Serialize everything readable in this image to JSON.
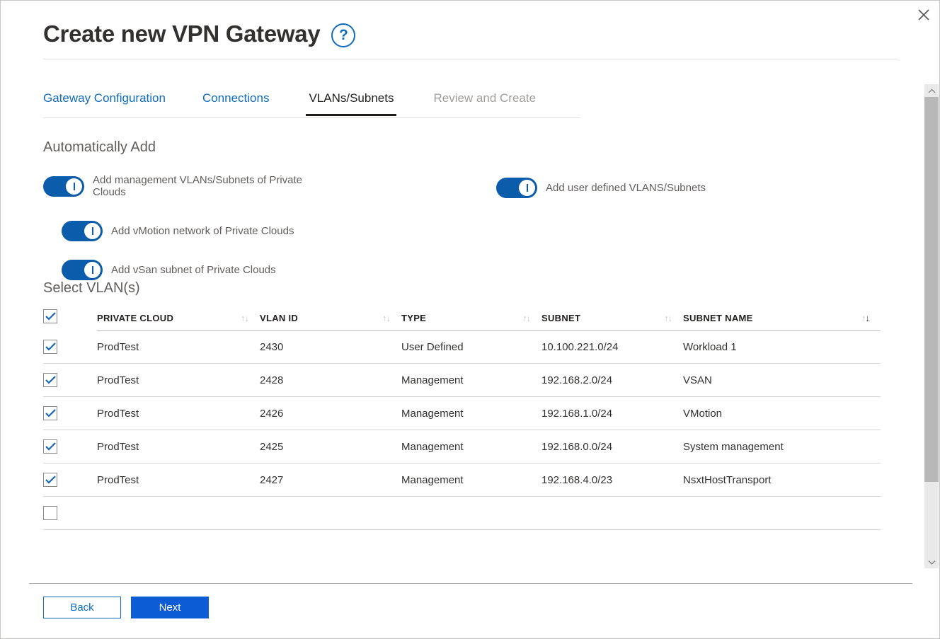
{
  "dialog": {
    "title": "Create new VPN Gateway",
    "help_label": "?",
    "close_label": "Close"
  },
  "tabs": [
    {
      "label": "Gateway Configuration",
      "state": "enabled"
    },
    {
      "label": "Connections",
      "state": "enabled"
    },
    {
      "label": "VLANs/Subnets",
      "state": "active"
    },
    {
      "label": "Review and Create",
      "state": "disabled"
    }
  ],
  "auto_add": {
    "heading": "Automatically Add",
    "toggles": [
      {
        "label": "Add management VLANs/Subnets of Private Clouds",
        "on": true
      },
      {
        "label": "Add vMotion network of Private Clouds",
        "on": true
      },
      {
        "label": "Add vSan subnet of Private Clouds",
        "on": true
      },
      {
        "label": "Add user defined VLANS/Subnets",
        "on": true
      }
    ]
  },
  "select_vlans": {
    "heading": "Select VLAN(s)",
    "header_checkbox_checked": true,
    "columns": [
      {
        "label": "PRIVATE CLOUD",
        "sort": "none"
      },
      {
        "label": "VLAN ID",
        "sort": "none"
      },
      {
        "label": "TYPE",
        "sort": "none"
      },
      {
        "label": "SUBNET",
        "sort": "none"
      },
      {
        "label": "SUBNET NAME",
        "sort": "desc"
      }
    ],
    "rows": [
      {
        "checked": true,
        "private_cloud": "ProdTest",
        "vlan_id": "2430",
        "type": "User Defined",
        "subnet": "10.100.221.0/24",
        "subnet_name": "Workload 1"
      },
      {
        "checked": true,
        "private_cloud": "ProdTest",
        "vlan_id": "2428",
        "type": "Management",
        "subnet": "192.168.2.0/24",
        "subnet_name": "VSAN"
      },
      {
        "checked": true,
        "private_cloud": "ProdTest",
        "vlan_id": "2426",
        "type": "Management",
        "subnet": "192.168.1.0/24",
        "subnet_name": "VMotion"
      },
      {
        "checked": true,
        "private_cloud": "ProdTest",
        "vlan_id": "2425",
        "type": "Management",
        "subnet": "192.168.0.0/24",
        "subnet_name": "System management"
      },
      {
        "checked": true,
        "private_cloud": "ProdTest",
        "vlan_id": "2427",
        "type": "Management",
        "subnet": "192.168.4.0/23",
        "subnet_name": "NsxtHostTransport"
      }
    ]
  },
  "footer": {
    "back_label": "Back",
    "next_label": "Next"
  },
  "colors": {
    "accent_blue": "#0f6cbd",
    "toggle_blue": "#0b5cab",
    "primary_button": "#0b5cd5",
    "text_dark": "#323130",
    "text_muted": "#605e5c",
    "text_disabled": "#a19f9d"
  }
}
